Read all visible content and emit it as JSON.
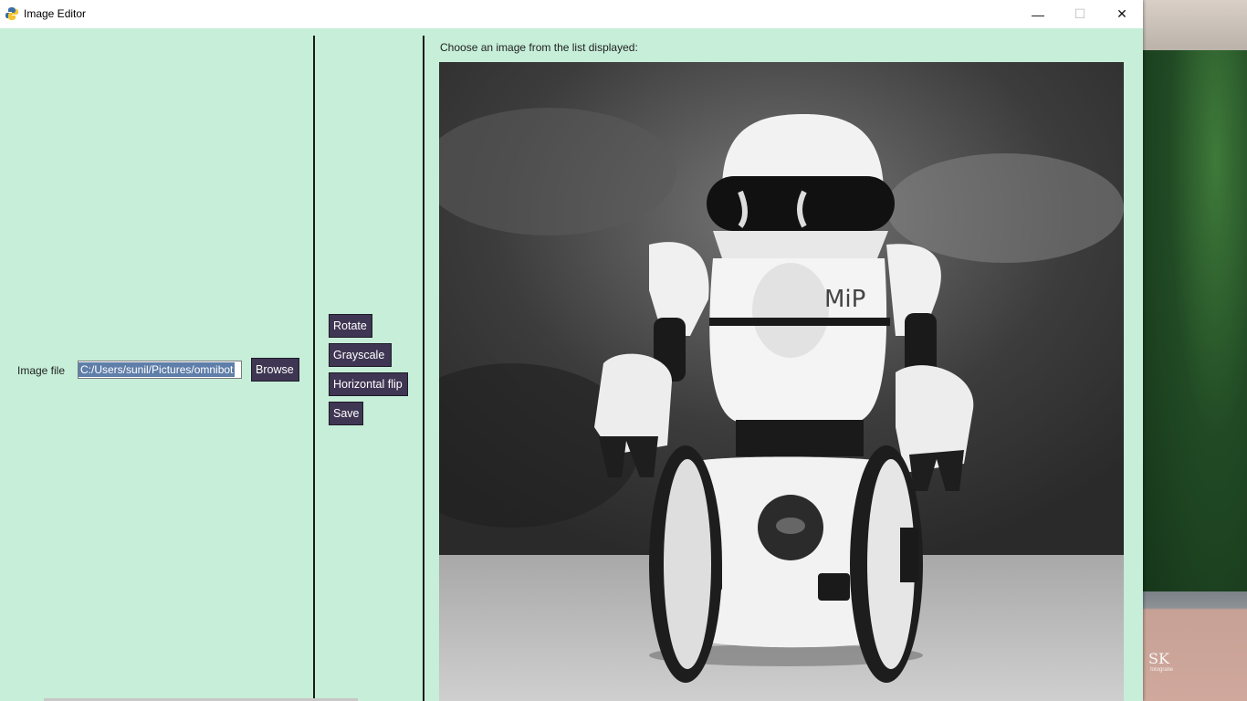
{
  "window": {
    "title": "Image Editor",
    "minimize_glyph": "—",
    "maximize_glyph": "☐",
    "close_glyph": "✕"
  },
  "file_panel": {
    "label": "Image file",
    "path_value": "C:/Users/sunil/Pictures/omnibot",
    "browse_label": "Browse"
  },
  "actions": {
    "rotate_label": "Rotate",
    "grayscale_label": "Grayscale",
    "hflip_label": "Horizontal flip",
    "save_label": "Save"
  },
  "preview": {
    "prompt": "Choose an image from the list displayed:",
    "robot_badge": "MiP"
  },
  "desktop": {
    "logo_text": "SK",
    "logo_subtext": "fotografie"
  },
  "colors": {
    "app_background": "#c6eed8",
    "button_background": "#3f3653",
    "selection": "#5f7ea9"
  },
  "icons": {
    "app": "python-icon",
    "minimize": "minimize-icon",
    "maximize": "maximize-icon",
    "close": "close-icon"
  }
}
